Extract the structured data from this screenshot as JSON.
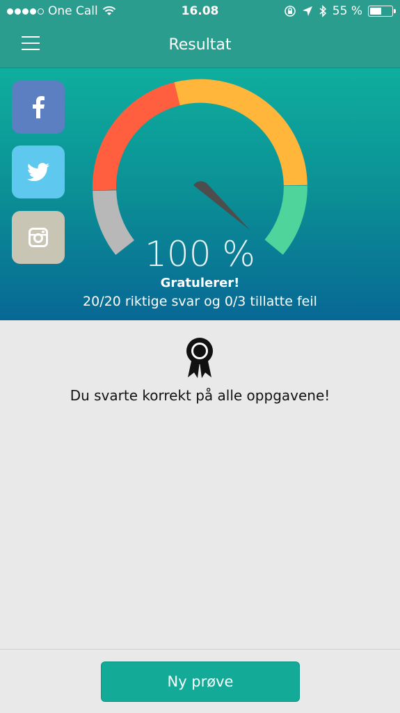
{
  "status_bar": {
    "carrier": "One Call",
    "time": "16.08",
    "battery_percent": "55 %",
    "battery_level": 0.55
  },
  "nav": {
    "title": "Resultat",
    "menu_icon": "hamburger-icon"
  },
  "social": {
    "facebook_icon": "facebook-icon",
    "twitter_icon": "twitter-icon",
    "instagram_icon": "instagram-icon"
  },
  "result": {
    "score_percent": "100 %",
    "score_value": 100,
    "headline": "Gratulerer!",
    "summary": "20/20 riktige svar og 0/3 tillatte feil"
  },
  "message": {
    "icon": "award-ribbon-icon",
    "text": "Du svarte korrekt på alle oppgavene!"
  },
  "footer": {
    "button_label": "Ny prøve"
  },
  "colors": {
    "bar": "#2a9d8f",
    "gauge_gray": "#b8b8b8",
    "gauge_red": "#ff5f3e",
    "gauge_orange": "#ffb63a",
    "gauge_green": "#4fd49b",
    "needle": "#4d4d4d",
    "button": "#13ab98"
  }
}
